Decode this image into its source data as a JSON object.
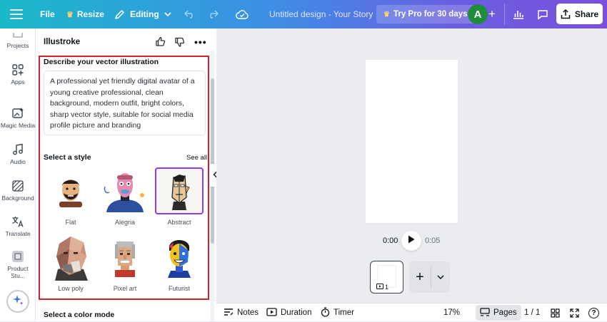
{
  "topbar": {
    "file_label": "File",
    "resize_label": "Resize",
    "editing_label": "Editing",
    "doc_title": "Untitled design - Your Story",
    "try_pro_label": "Try Pro for 30 days",
    "avatar_letter": "A",
    "share_label": "Share"
  },
  "left_rail": {
    "items": [
      {
        "label": "Projects",
        "icon": "folder-icon"
      },
      {
        "label": "Apps",
        "icon": "apps-icon"
      },
      {
        "label": "Magic Media",
        "icon": "magic-media-icon"
      },
      {
        "label": "Audio",
        "icon": "music-note-icon"
      },
      {
        "label": "Background",
        "icon": "background-icon"
      },
      {
        "label": "Translate",
        "icon": "translate-icon"
      },
      {
        "label": "Product Stu...",
        "icon": "product-studio-icon"
      }
    ]
  },
  "panel": {
    "title": "Illustroke",
    "describe_label": "Describe your vector illustration",
    "prompt_text": "A professional yet friendly digital avatar of a young creative professional, clean background, modern outfit, bright colors, sharp vector style, suitable for social media profile picture and branding",
    "style_heading": "Select a style",
    "see_all_label": "See all",
    "styles": [
      {
        "label": "Flat",
        "selected": false
      },
      {
        "label": "Alegria",
        "selected": false
      },
      {
        "label": "Abstract",
        "selected": true
      },
      {
        "label": "Low poly",
        "selected": false
      },
      {
        "label": "Pixel art",
        "selected": false
      },
      {
        "label": "Futurist",
        "selected": false
      }
    ],
    "color_mode_heading": "Select a color mode"
  },
  "playback": {
    "current_time": "0:00",
    "total_time": "0:05",
    "page_thumb_number": "1"
  },
  "bottombar": {
    "notes_label": "Notes",
    "duration_label": "Duration",
    "timer_label": "Timer",
    "zoom_level": "17%",
    "pages_label": "Pages",
    "page_count": "1 / 1",
    "help_label": "?"
  },
  "colors": {
    "highlight_red": "#d3212c",
    "selected_purple": "#8b3dff",
    "accent_blue": "#3e8ee6"
  }
}
